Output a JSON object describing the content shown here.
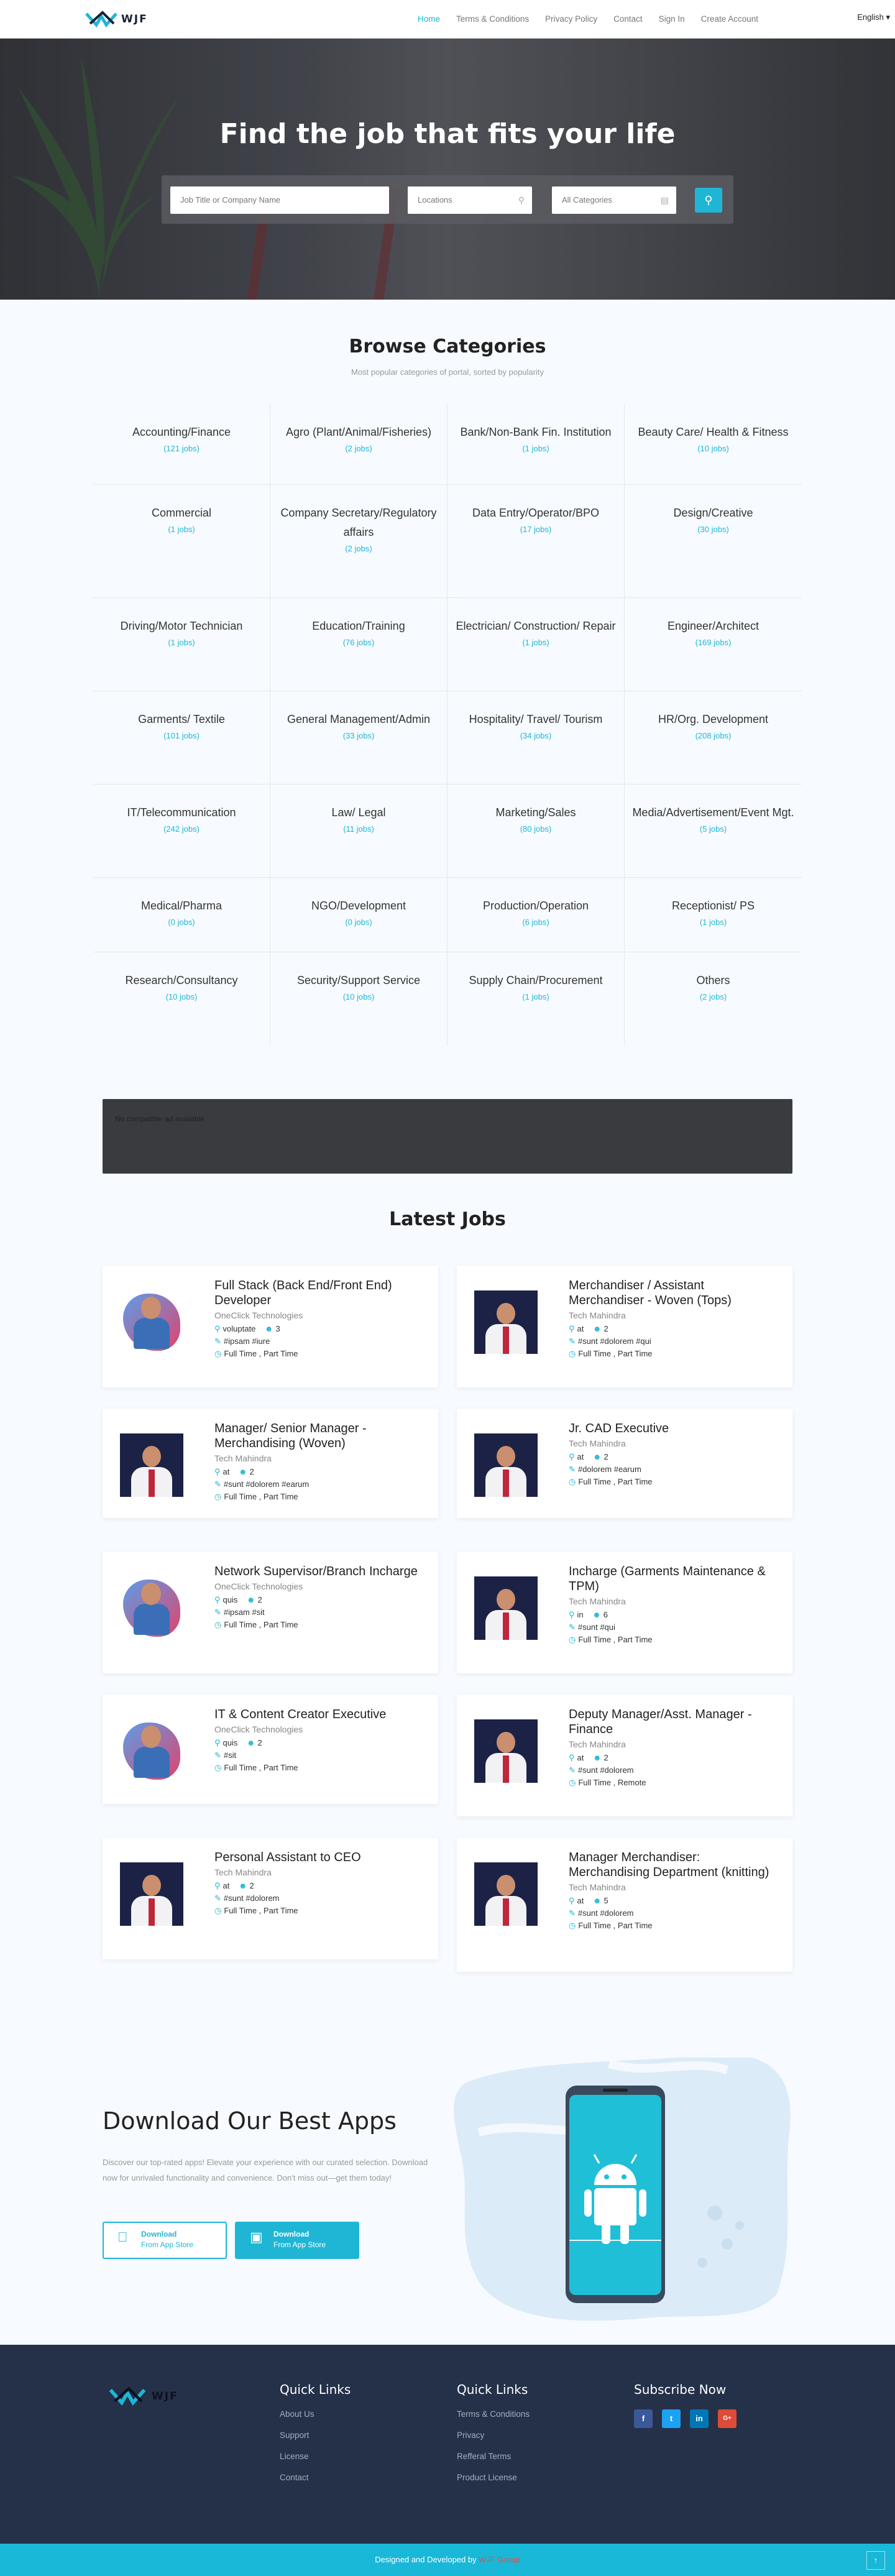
{
  "nav": {
    "logo_text": "WJF",
    "items": [
      "Home",
      "Terms & Conditions",
      "Privacy Policy",
      "Contact",
      "Sign In",
      "Create Account"
    ],
    "language": "English"
  },
  "hero": {
    "title": "Find the job that fits your life",
    "search_placeholder": "Job Title or Company Name",
    "location_placeholder": "Locations",
    "category_value": "All Categories"
  },
  "browse": {
    "title": "Browse Categories",
    "subtitle": "Most popular categories of portal, sorted by popularity",
    "categories": [
      {
        "name": "Accounting/Finance",
        "count": "(121 jobs)"
      },
      {
        "name": "Agro (Plant/Animal/Fisheries)",
        "count": "(2 jobs)"
      },
      {
        "name": "Bank/Non-Bank Fin. Institution",
        "count": "(1 jobs)"
      },
      {
        "name": "Beauty Care/ Health & Fitness",
        "count": "(10 jobs)"
      },
      {
        "name": "Commercial",
        "count": "(1 jobs)"
      },
      {
        "name": "Company Secretary/Regulatory affairs",
        "count": "(2 jobs)"
      },
      {
        "name": "Data Entry/Operator/BPO",
        "count": "(17 jobs)"
      },
      {
        "name": "Design/Creative",
        "count": "(30 jobs)"
      },
      {
        "name": "Driving/Motor Technician",
        "count": "(1 jobs)"
      },
      {
        "name": "Education/Training",
        "count": "(76 jobs)"
      },
      {
        "name": "Electrician/ Construction/ Repair",
        "count": "(1 jobs)"
      },
      {
        "name": "Engineer/Architect",
        "count": "(169 jobs)"
      },
      {
        "name": "Garments/ Textile",
        "count": "(101 jobs)"
      },
      {
        "name": "General Management/Admin",
        "count": "(33 jobs)"
      },
      {
        "name": "Hospitality/ Travel/ Tourism",
        "count": "(34 jobs)"
      },
      {
        "name": "HR/Org. Development",
        "count": "(208 jobs)"
      },
      {
        "name": "IT/Telecommunication",
        "count": "(242 jobs)"
      },
      {
        "name": "Law/ Legal",
        "count": "(11 jobs)"
      },
      {
        "name": "Marketing/Sales",
        "count": "(80 jobs)"
      },
      {
        "name": "Media/Advertisement/Event Mgt.",
        "count": "(5 jobs)"
      },
      {
        "name": "Medical/Pharma",
        "count": "(0 jobs)"
      },
      {
        "name": "NGO/Development",
        "count": "(0 jobs)"
      },
      {
        "name": "Production/Operation",
        "count": "(6 jobs)"
      },
      {
        "name": "Receptionist/ PS",
        "count": "(1 jobs)"
      },
      {
        "name": "Research/Consultancy",
        "count": "(10 jobs)"
      },
      {
        "name": "Security/Support Service",
        "count": "(10 jobs)"
      },
      {
        "name": "Supply Chain/Procurement",
        "count": "(1 jobs)"
      },
      {
        "name": "Others",
        "count": "(2 jobs)"
      }
    ]
  },
  "ad": {
    "text": "No compatible ad available"
  },
  "latest": {
    "title": "Latest Jobs",
    "jobs": [
      {
        "title": "Full Stack (Back End/Front End) Developer",
        "company": "OneClick Technologies",
        "location": "voluptate",
        "vacancy": "3",
        "tags": "#ipsam #iure",
        "types": "Full Time , Part Time",
        "logo": "blob"
      },
      {
        "title": "Merchandiser / Assistant Merchandiser - Woven (Tops)",
        "company": "Tech Mahindra",
        "location": "at",
        "vacancy": "2",
        "tags": "#sunt #dolorem #qui",
        "types": "Full Time , Part Time",
        "logo": "portrait"
      },
      {
        "title": "Manager/ Senior Manager - Merchandising (Woven)",
        "company": "Tech Mahindra",
        "location": "at",
        "vacancy": "2",
        "tags": "#sunt #dolorem #earum",
        "types": "Full Time , Part Time",
        "logo": "portrait"
      },
      {
        "title": "Jr. CAD Executive",
        "company": "Tech Mahindra",
        "location": "at",
        "vacancy": "2",
        "tags": "#dolorem #earum",
        "types": "Full Time , Part Time",
        "logo": "portrait"
      },
      {
        "title": "Network Supervisor/Branch Incharge",
        "company": "OneClick Technologies",
        "location": "quis",
        "vacancy": "2",
        "tags": "#ipsam #sit",
        "types": "Full Time , Part Time",
        "logo": "blob"
      },
      {
        "title": "Incharge (Garments Maintenance & TPM)",
        "company": "Tech Mahindra",
        "location": "in",
        "vacancy": "6",
        "tags": "#sunt #qui",
        "types": "Full Time , Part Time",
        "logo": "portrait"
      },
      {
        "title": "IT & Content Creator Executive",
        "company": "OneClick Technologies",
        "location": "quis",
        "vacancy": "2",
        "tags": "#sit",
        "types": "Full Time , Part Time",
        "logo": "blob"
      },
      {
        "title": "Deputy Manager/Asst. Manager - Finance",
        "company": "Tech Mahindra",
        "location": "at",
        "vacancy": "2",
        "tags": "#sunt #dolorem",
        "types": "Full Time , Remote",
        "logo": "portrait"
      },
      {
        "title": "Personal Assistant to CEO",
        "company": "Tech Mahindra",
        "location": "at",
        "vacancy": "2",
        "tags": "#sunt #dolorem",
        "types": "Full Time , Part Time",
        "logo": "portrait"
      },
      {
        "title": "Manager Merchandiser: Merchandising Department (knitting)",
        "company": "Tech Mahindra",
        "location": "at",
        "vacancy": "5",
        "tags": "#sunt #dolorem",
        "types": "Full Time , Part Time",
        "logo": "portrait"
      }
    ]
  },
  "app": {
    "title": "Download Our Best Apps",
    "description": "Discover our top-rated apps! Elevate your experience with our curated selection. Download now for unrivaled functionality and convenience. Don't miss out—get them today!",
    "btn1_l1": "Download",
    "btn1_l2": "From App Store",
    "btn2_l1": "Download",
    "btn2_l2": "From App Store"
  },
  "footer": {
    "col1_title": "Quick Links",
    "col1_links": [
      "About Us",
      "Support",
      "License",
      "Contact"
    ],
    "col2_title": "Quick Links",
    "col2_links": [
      "Terms & Conditions",
      "Privacy",
      "Refferal Terms",
      "Product License"
    ],
    "col3_title": "Subscribe Now",
    "social": [
      "f",
      "t",
      "in",
      "G+"
    ],
    "bottom_text": "Designed and Developed by",
    "bottom_author": "WJF Group"
  },
  "colors": {
    "accent": "#1fb6d5",
    "footer": "#253149",
    "bottom_bar": "#1ab8d8"
  }
}
